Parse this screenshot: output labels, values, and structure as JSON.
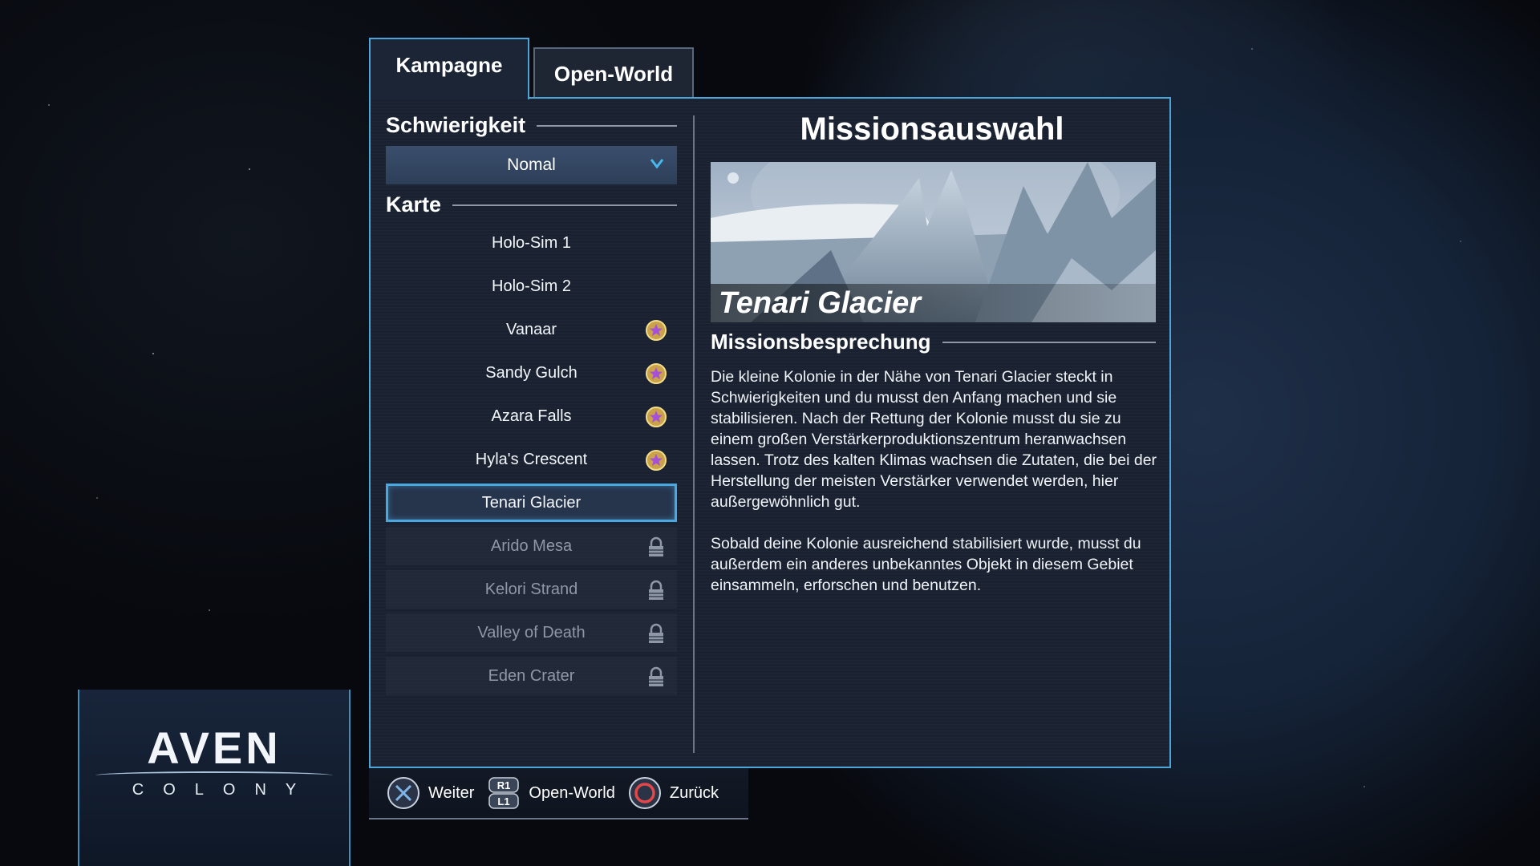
{
  "tabs": [
    {
      "label": "Kampagne",
      "active": true
    },
    {
      "label": "Open-World",
      "active": false
    }
  ],
  "difficulty": {
    "label": "Schwierigkeit",
    "selected": "Nomal"
  },
  "map_section": {
    "label": "Karte",
    "items": [
      {
        "label": "Holo-Sim 1",
        "state": "available"
      },
      {
        "label": "Holo-Sim 2",
        "state": "available"
      },
      {
        "label": "Vanaar",
        "state": "completed",
        "icon": "star-medal-icon"
      },
      {
        "label": "Sandy Gulch",
        "state": "completed",
        "icon": "star-medal-icon"
      },
      {
        "label": "Azara Falls",
        "state": "completed",
        "icon": "star-medal-icon"
      },
      {
        "label": "Hyla's Crescent",
        "state": "completed",
        "icon": "star-medal-icon"
      },
      {
        "label": "Tenari Glacier",
        "state": "selected"
      },
      {
        "label": "Arido Mesa",
        "state": "locked",
        "icon": "lock-icon"
      },
      {
        "label": "Kelori Strand",
        "state": "locked",
        "icon": "lock-icon"
      },
      {
        "label": "Valley of Death",
        "state": "locked",
        "icon": "lock-icon"
      },
      {
        "label": "Eden Crater",
        "state": "locked",
        "icon": "lock-icon"
      }
    ]
  },
  "mission": {
    "title": "Missionsauswahl",
    "image_label": "Tenari Glacier",
    "briefing_label": "Missionsbesprechung",
    "briefing_paragraphs": [
      "Die kleine Kolonie in der Nähe von Tenari Glacier steckt in Schwierigkeiten und du musst den Anfang machen und sie stabilisieren. Nach der Rettung der Kolonie musst du sie zu einem großen Verstärkerproduktionszentrum heranwachsen lassen.  Trotz des kalten Klimas wachsen die Zutaten, die bei der Herstellung der meisten Verstärker verwendet werden, hier außergewöhnlich gut.",
      "Sobald deine Kolonie ausreichend stabilisiert wurde, musst du außerdem ein anderes unbekanntes Objekt in diesem Gebiet einsammeln, erforschen und benutzen."
    ]
  },
  "controls": [
    {
      "button": "cross-button-icon",
      "label": "Weiter"
    },
    {
      "button": "r1-l1-button-icon",
      "label": "Open-World"
    },
    {
      "button": "circle-button-icon",
      "label": "Zurück"
    }
  ],
  "logo": {
    "title": "AVEN",
    "subtitle": "COLONY"
  },
  "colors": {
    "accent": "#4da4d8",
    "panel": "#1a2232",
    "dropdown_chevron": "#47b7ee",
    "circle_button": "#e3474a"
  }
}
